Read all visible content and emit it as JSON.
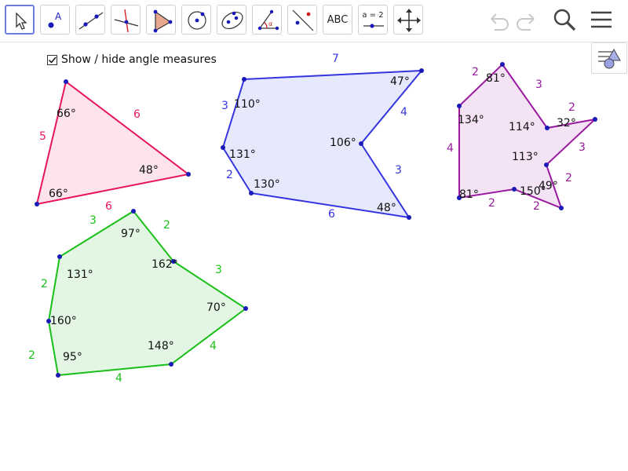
{
  "toolbar": {
    "tools": [
      {
        "name": "move-tool",
        "icon": "arrow-pointer-icon",
        "active": true
      },
      {
        "name": "point-tool",
        "icon": "point-icon"
      },
      {
        "name": "line-tool",
        "icon": "line-icon"
      },
      {
        "name": "perpendicular-line-tool",
        "icon": "perpendicular-icon"
      },
      {
        "name": "polygon-tool",
        "icon": "polygon-icon"
      },
      {
        "name": "circle-tool",
        "icon": "circle-icon"
      },
      {
        "name": "ellipse-tool",
        "icon": "ellipse-icon"
      },
      {
        "name": "angle-tool",
        "icon": "angle-icon"
      },
      {
        "name": "reflect-tool",
        "icon": "reflect-icon"
      },
      {
        "name": "text-tool",
        "icon": "text-icon",
        "label": "ABC"
      },
      {
        "name": "slider-tool",
        "icon": "slider-icon",
        "label": "a = 2"
      },
      {
        "name": "move-graphics-view-tool",
        "icon": "move-view-icon"
      }
    ],
    "undo_icon": "undo-icon",
    "redo_icon": "redo-icon",
    "search_icon": "search-icon",
    "menu_icon": "hamburger-menu-icon"
  },
  "stylebar_icon": "style-bar-toggle-icon",
  "checkbox": {
    "label": "Show / hide angle measures",
    "checked": true
  },
  "colors": {
    "triangle": "#e8155d",
    "triangle_fill": "#fde3ec",
    "hexagon_blue": "#3434e0",
    "hexagon_blue_fill": "#e6e8fb",
    "heptagon_purple": "#9a1a9f",
    "heptagon_purple_fill": "#f4e3f4",
    "hexagon_green": "#19c019",
    "hexagon_green_fill": "#e3f6e3",
    "vertex": "#1a1ab8"
  },
  "shapes": {
    "triangle": {
      "side_labels": [
        "6",
        "5",
        "6"
      ],
      "angle_labels": [
        "66°",
        "48°",
        "66°"
      ]
    },
    "blue_hexagon": {
      "side_labels": [
        "7",
        "4",
        "3",
        "6",
        "2",
        "3"
      ],
      "angle_labels": [
        "110°",
        "47°",
        "106°",
        "48°",
        "130°",
        "131°"
      ]
    },
    "purple_heptagon": {
      "side_labels": [
        "2",
        "3",
        "2",
        "3",
        "2",
        "2",
        "2",
        "4"
      ],
      "angle_labels": [
        "81°",
        "114°",
        "32°",
        "113°",
        "49°",
        "150°",
        "81°",
        "134°"
      ]
    },
    "green_hexagon": {
      "side_labels": [
        "3",
        "2",
        "3",
        "4",
        "4",
        "2",
        "2"
      ],
      "angle_labels": [
        "97°",
        "162°",
        "70°",
        "148°",
        "95°",
        "160°",
        "131°"
      ]
    }
  }
}
